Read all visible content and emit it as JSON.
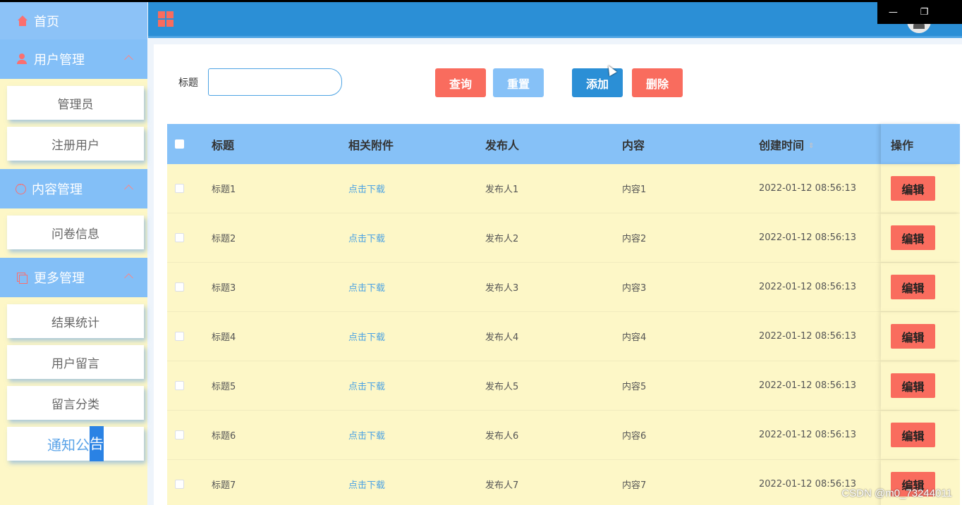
{
  "sidebar": {
    "home": "首页",
    "groups": [
      {
        "label": "用户管理",
        "items": [
          "管理员",
          "注册用户"
        ]
      },
      {
        "label": "内容管理",
        "items": [
          "问卷信息"
        ]
      },
      {
        "label": "更多管理",
        "items": [
          "结果统计",
          "用户留言",
          "留言分类"
        ]
      }
    ],
    "active_item_prefix": "通知公",
    "active_item_selected": "告"
  },
  "search": {
    "label": "标题",
    "value": "",
    "placeholder": ""
  },
  "buttons": {
    "query": "查询",
    "reset": "重置",
    "add": "添加",
    "delete": "删除"
  },
  "table": {
    "headers": [
      "标题",
      "相关附件",
      "发布人",
      "内容",
      "创建时间",
      "操作"
    ],
    "rows": [
      {
        "title": "标题1",
        "attach": "点击下载",
        "publisher": "发布人1",
        "content": "内容1",
        "time": "2022-01-12 08:56:13",
        "op": "编辑"
      },
      {
        "title": "标题2",
        "attach": "点击下载",
        "publisher": "发布人2",
        "content": "内容2",
        "time": "2022-01-12 08:56:13",
        "op": "编辑"
      },
      {
        "title": "标题3",
        "attach": "点击下载",
        "publisher": "发布人3",
        "content": "内容3",
        "time": "2022-01-12 08:56:13",
        "op": "编辑"
      },
      {
        "title": "标题4",
        "attach": "点击下载",
        "publisher": "发布人4",
        "content": "内容4",
        "time": "2022-01-12 08:56:13",
        "op": "编辑"
      },
      {
        "title": "标题5",
        "attach": "点击下载",
        "publisher": "发布人5",
        "content": "内容5",
        "time": "2022-01-12 08:56:13",
        "op": "编辑"
      },
      {
        "title": "标题6",
        "attach": "点击下载",
        "publisher": "发布人6",
        "content": "内容6",
        "time": "2022-01-12 08:56:13",
        "op": "编辑"
      },
      {
        "title": "标题7",
        "attach": "点击下载",
        "publisher": "发布人7",
        "content": "内容7",
        "time": "2022-01-12 08:56:13",
        "op": "编辑"
      }
    ]
  },
  "window_controls": {
    "minimize": "—",
    "restore": "❐"
  },
  "watermark": "CSDN @m0_73244011",
  "colors": {
    "primary": "#2b8fd6",
    "sidebar_bg": "#fdf7c7",
    "header_light": "#86c1f7",
    "danger": "#f96c5e"
  },
  "icons": {
    "home": "home-icon",
    "user": "user-icon",
    "chat": "chat-icon",
    "copy": "copy-icon",
    "grid": "grid-menu-icon",
    "sort": "sort-icon",
    "collapse": "chevron-up-icon"
  }
}
